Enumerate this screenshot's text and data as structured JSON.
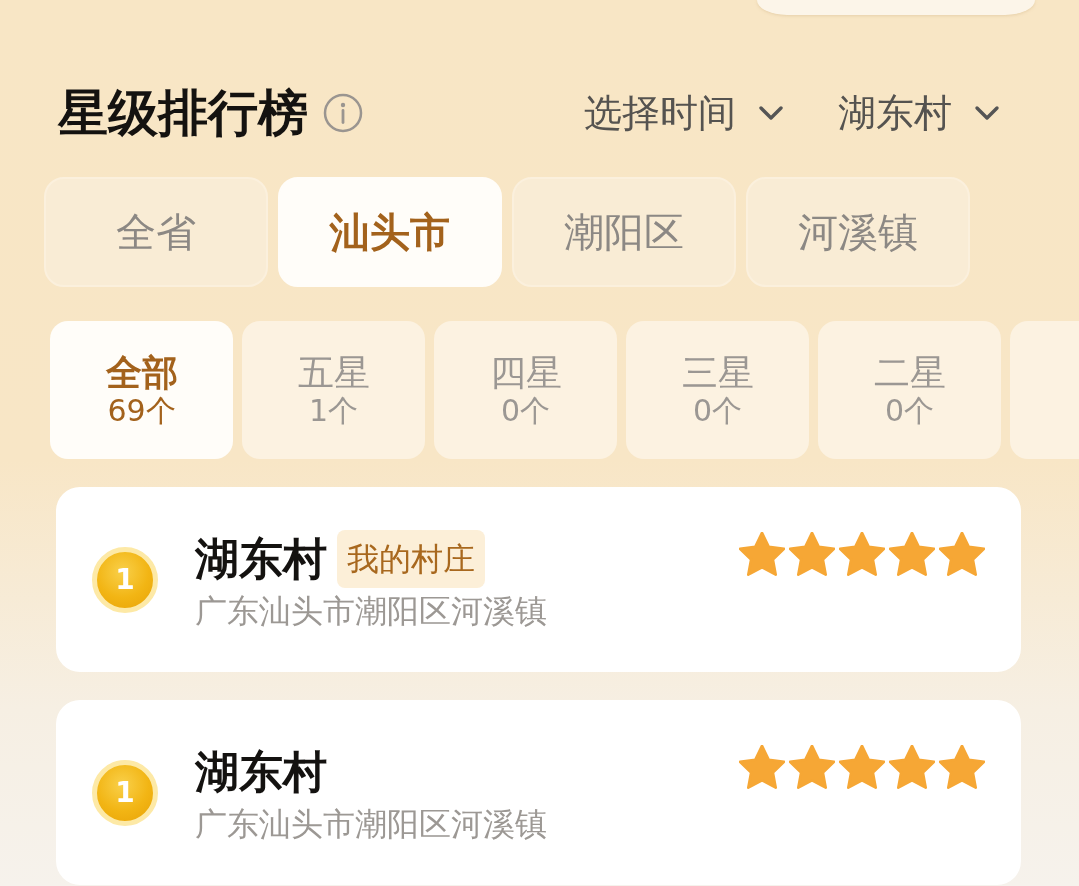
{
  "header": {
    "title": "星级排行榜",
    "filters": [
      {
        "label": "选择时间"
      },
      {
        "label": "湖东村"
      }
    ]
  },
  "region_tabs": [
    {
      "label": "全省",
      "selected": false
    },
    {
      "label": "汕头市",
      "selected": true
    },
    {
      "label": "潮阳区",
      "selected": false
    },
    {
      "label": "河溪镇",
      "selected": false
    }
  ],
  "star_filters": [
    {
      "label": "全部",
      "count": "69个",
      "selected": true
    },
    {
      "label": "五星",
      "count": "1个",
      "selected": false
    },
    {
      "label": "四星",
      "count": "0个",
      "selected": false
    },
    {
      "label": "三星",
      "count": "0个",
      "selected": false
    },
    {
      "label": "二星",
      "count": "0个",
      "selected": false
    },
    {
      "selected": false
    }
  ],
  "ranking": [
    {
      "rank": "1",
      "name": "湖东村",
      "badge": "我的村庄",
      "address": "广东汕头市潮阳区河溪镇",
      "stars": 5
    },
    {
      "rank": "1",
      "name": "湖东村",
      "address": "广东汕头市潮阳区河溪镇",
      "stars": 5
    }
  ]
}
